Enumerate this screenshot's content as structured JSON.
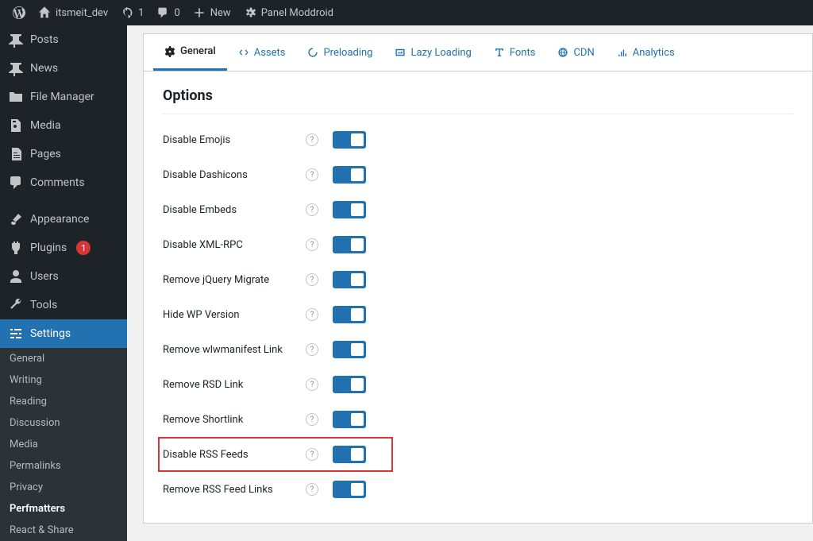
{
  "adminbar": {
    "site_name": "itsmeit_dev",
    "updates": "1",
    "comments": "0",
    "new": "New",
    "panel": "Panel Moddroid"
  },
  "sidebar": {
    "items": [
      {
        "label": "Posts",
        "icon": "pin"
      },
      {
        "label": "News",
        "icon": "pin"
      },
      {
        "label": "File Manager",
        "icon": "folder"
      },
      {
        "label": "Media",
        "icon": "media"
      },
      {
        "label": "Pages",
        "icon": "pages"
      },
      {
        "label": "Comments",
        "icon": "comment"
      },
      {
        "label": "Appearance",
        "icon": "brush"
      },
      {
        "label": "Plugins",
        "icon": "plugin",
        "badge": "1"
      },
      {
        "label": "Users",
        "icon": "user"
      },
      {
        "label": "Tools",
        "icon": "wrench"
      },
      {
        "label": "Settings",
        "icon": "sliders",
        "active": true
      }
    ],
    "submenu": [
      {
        "label": "General"
      },
      {
        "label": "Writing"
      },
      {
        "label": "Reading"
      },
      {
        "label": "Discussion"
      },
      {
        "label": "Media"
      },
      {
        "label": "Permalinks"
      },
      {
        "label": "Privacy"
      },
      {
        "label": "Perfmatters",
        "selected": true
      },
      {
        "label": "React & Share"
      }
    ]
  },
  "tabs": [
    {
      "label": "General",
      "active": true
    },
    {
      "label": "Assets"
    },
    {
      "label": "Preloading"
    },
    {
      "label": "Lazy Loading"
    },
    {
      "label": "Fonts"
    },
    {
      "label": "CDN"
    },
    {
      "label": "Analytics"
    }
  ],
  "options": {
    "title": "Options",
    "rows": [
      {
        "label": "Disable Emojis",
        "on": true
      },
      {
        "label": "Disable Dashicons",
        "on": true
      },
      {
        "label": "Disable Embeds",
        "on": true
      },
      {
        "label": "Disable XML-RPC",
        "on": true
      },
      {
        "label": "Remove jQuery Migrate",
        "on": true
      },
      {
        "label": "Hide WP Version",
        "on": true
      },
      {
        "label": "Remove wlwmanifest Link",
        "on": true
      },
      {
        "label": "Remove RSD Link",
        "on": true
      },
      {
        "label": "Remove Shortlink",
        "on": true
      },
      {
        "label": "Disable RSS Feeds",
        "on": true,
        "highlighted": true
      },
      {
        "label": "Remove RSS Feed Links",
        "on": true
      }
    ]
  }
}
